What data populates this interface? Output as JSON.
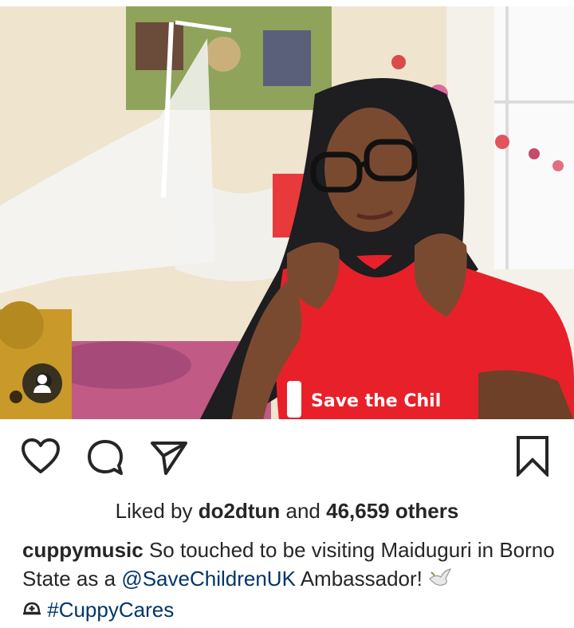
{
  "post": {
    "photo_shirt_text": "Save the Chil",
    "likes": {
      "prefix": "Liked by ",
      "user": "do2dtun",
      "middle": " and ",
      "count": "46,659 others"
    },
    "caption": {
      "username": "cuppymusic",
      "text1": " So touched to be visiting Maiduguri in Borno State as a ",
      "mention": "@SaveChildrenUK",
      "text2": " Ambassador! ",
      "hashtag": "#CuppyCares"
    }
  },
  "icons": {
    "tag": "person-tag-icon",
    "like": "heart-icon",
    "comment": "comment-bubble-icon",
    "share": "paper-plane-icon",
    "save": "bookmark-icon",
    "dove": "dove-emoji-icon",
    "helmet": "rescue-helmet-emoji-icon"
  },
  "colors": {
    "text": "#262626",
    "link": "#003569",
    "shirt": "#e8202a"
  }
}
